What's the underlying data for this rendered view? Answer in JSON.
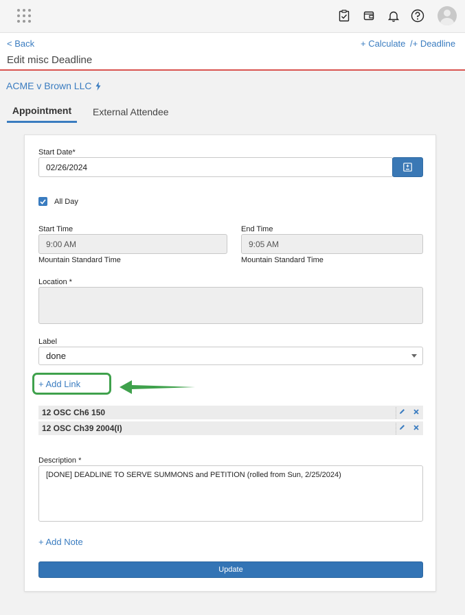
{
  "header": {
    "back_label": "< Back",
    "title": "Edit misc Deadline",
    "calculate_label": "+ Calculate",
    "deadline_label": "/+ Deadline"
  },
  "case": {
    "name": "ACME v Brown LLC"
  },
  "tabs": [
    {
      "label": "Appointment",
      "active": true
    },
    {
      "label": "External Attendee",
      "active": false
    }
  ],
  "form": {
    "start_date_label": "Start Date*",
    "start_date_value": "02/26/2024",
    "all_day_label": "All Day",
    "all_day_checked": true,
    "start_time_label": "Start Time",
    "start_time_value": "9:00 AM",
    "start_tz": "Mountain Standard Time",
    "end_time_label": "End Time",
    "end_time_value": "9:05 AM",
    "end_tz": "Mountain Standard Time",
    "location_label": "Location *",
    "location_value": "",
    "label_label": "Label",
    "label_value": "done",
    "add_link_label": "+ Add Link",
    "links": [
      {
        "text": "12 OSC Ch6 150"
      },
      {
        "text": "12 OSC Ch39 2004(I)"
      }
    ],
    "description_label": "Description *",
    "description_value": "[DONE] DEADLINE TO SERVE SUMMONS and PETITION (rolled from Sun, 2/25/2024)",
    "add_note_label": "+ Add Note",
    "update_label": "Update"
  },
  "colors": {
    "accent": "#3a7cc0",
    "highlight": "#3fa14c",
    "header_border": "#d9534f",
    "button": "#3374b5"
  },
  "icons": [
    "apps-grid-icon",
    "clipboard-check-icon",
    "wallet-icon",
    "bell-icon",
    "help-icon",
    "avatar",
    "lightning-icon",
    "calendar-plus-minus-icon",
    "edit-icon",
    "close-icon",
    "annotation-arrow"
  ]
}
